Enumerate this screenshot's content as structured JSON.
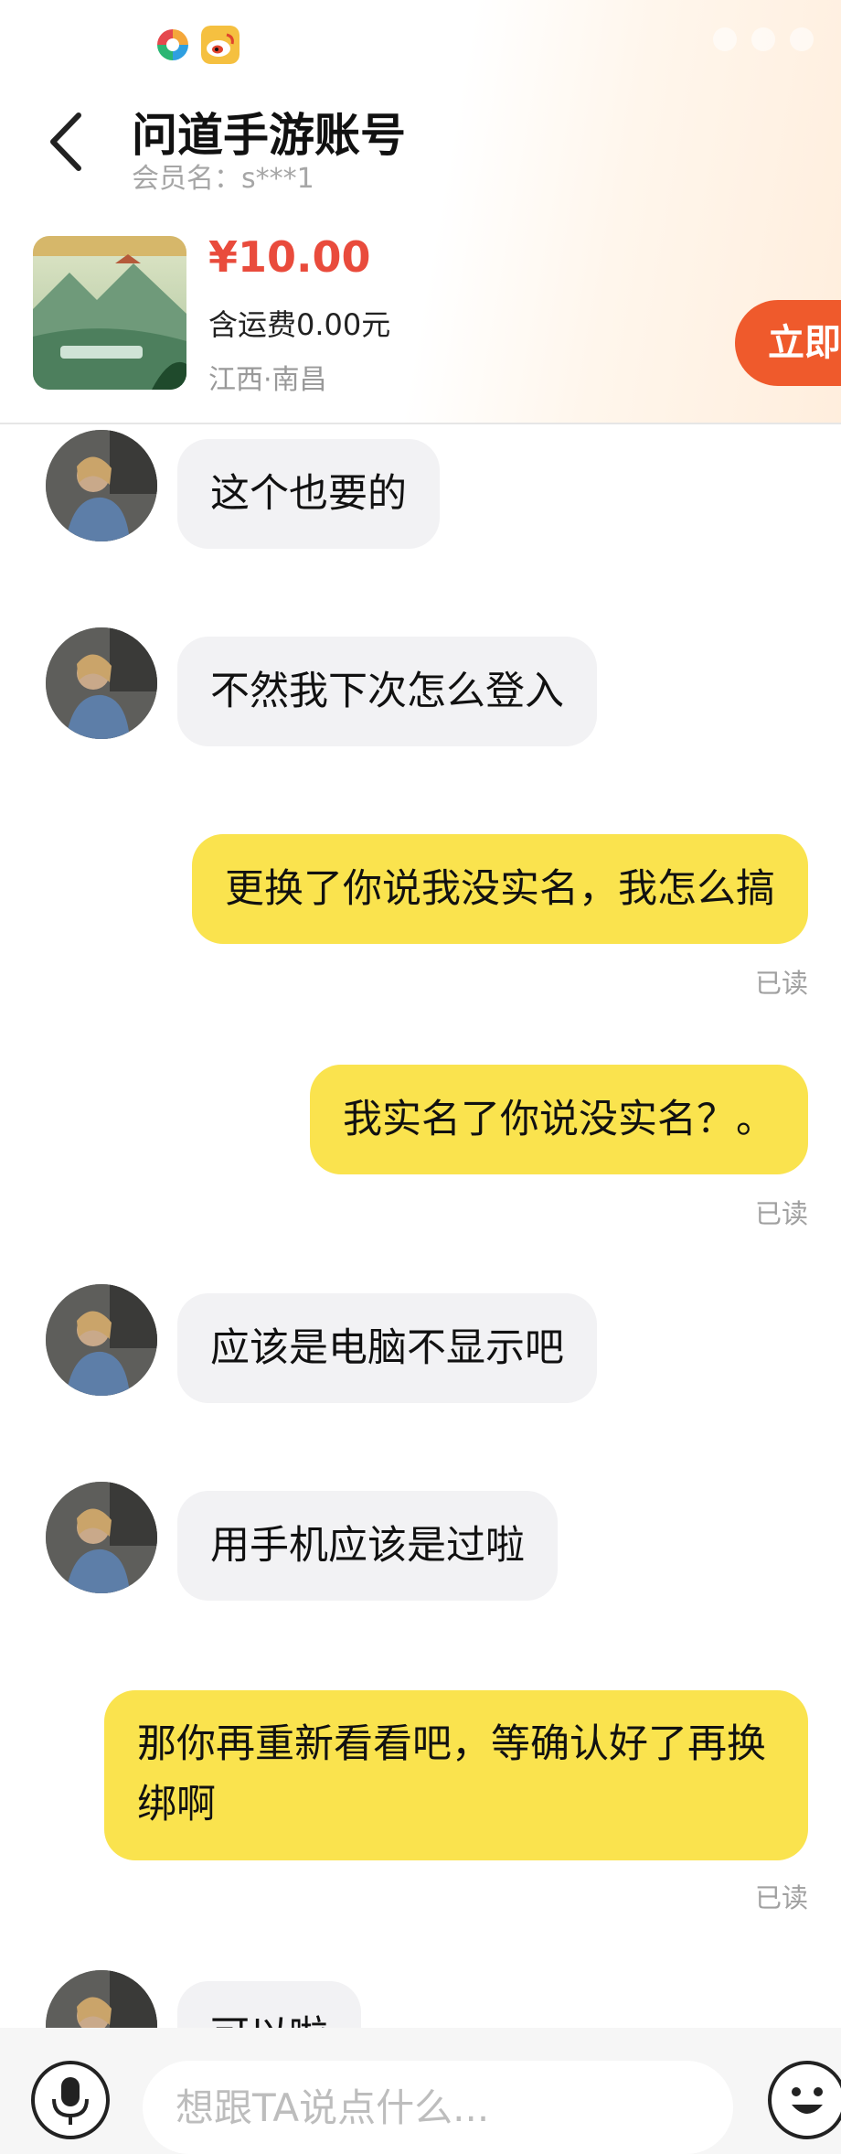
{
  "header": {
    "title": "问道手游账号",
    "member_label": "会员名：s***1",
    "back_icon": "chevron-left-icon"
  },
  "status_bar": {
    "apps": [
      "app-multicolor-icon",
      "weibo-icon"
    ]
  },
  "item": {
    "price": "¥10.00",
    "shipping": "含运费0.00元",
    "location": "江西·南昌",
    "buy_label": "立即"
  },
  "messages": [
    {
      "side": "in",
      "text": "这个也要的"
    },
    {
      "side": "in",
      "text": "不然我下次怎么登入"
    },
    {
      "side": "out",
      "text": "更换了你说我没实名，我怎么搞",
      "status": "已读"
    },
    {
      "side": "out",
      "text": "我实名了你说没实名？。",
      "status": "已读"
    },
    {
      "side": "in",
      "text": "应该是电脑不显示吧"
    },
    {
      "side": "in",
      "text": "用手机应该是过啦"
    },
    {
      "side": "out",
      "text": "那你再重新看看吧，等确认好了再换绑啊",
      "status": "已读"
    },
    {
      "side": "in",
      "text": "可以啦"
    }
  ],
  "input_bar": {
    "placeholder": "想跟TA说点什么...",
    "mic_icon": "microphone-icon",
    "emoji_icon": "emoji-icon"
  },
  "colors": {
    "price": "#e94b3c",
    "buy_button": "#ef5a2c",
    "outgoing_bubble": "#fae34e",
    "incoming_bubble": "#f2f2f4"
  }
}
